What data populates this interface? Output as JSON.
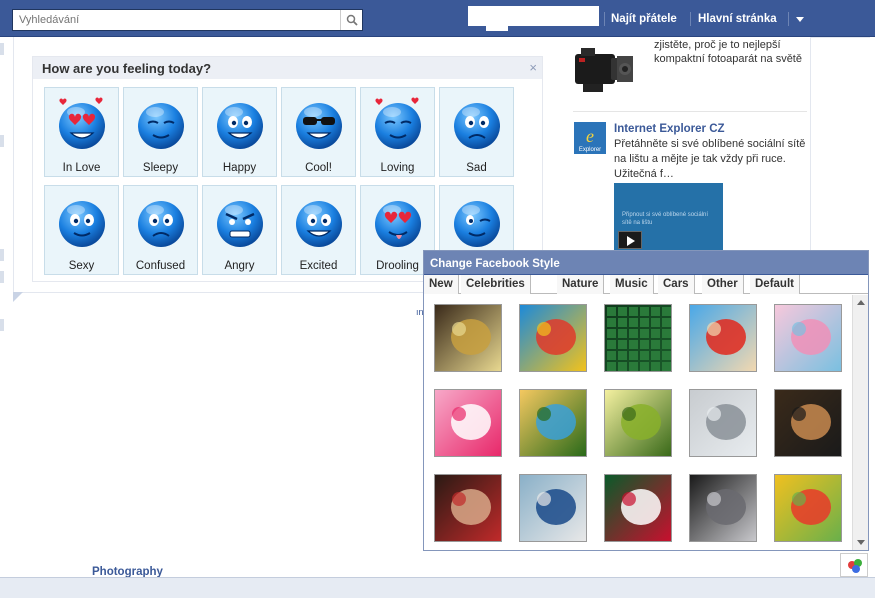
{
  "header": {
    "search_placeholder": "Vyhledávání",
    "nav_friends": "Najít přátele",
    "nav_home": "Hlavní stránka"
  },
  "feelings": {
    "title": "How are you feeling today?",
    "close": "×",
    "items": [
      {
        "label": "In Love"
      },
      {
        "label": "Sleepy"
      },
      {
        "label": "Happy"
      },
      {
        "label": "Cool!"
      },
      {
        "label": "Loving"
      },
      {
        "label": "Sad"
      },
      {
        "label": "Sexy"
      },
      {
        "label": "Confused"
      },
      {
        "label": "Angry"
      },
      {
        "label": "Excited"
      },
      {
        "label": "Drooling"
      },
      {
        "label": ""
      }
    ]
  },
  "sidebar": {
    "camera_text": "zjistěte, proč je to nejlepší kompaktní fotoaparát na světě",
    "ie_title": "Internet Explorer CZ",
    "ie_text": "Přetáhněte si své oblíbené sociální sítě na lištu a mějte je tak vždy při ruce. Užitečná f…",
    "video_caption": "Připnout si své oblíbené sociální sítě na lištu"
  },
  "style_popup": {
    "title": "Change Facebook Style",
    "tabs": [
      "New",
      "Celebrities",
      "Nature",
      "Music",
      "Cars",
      "Other",
      "Default"
    ]
  },
  "misc": {
    "small_text": "ın",
    "photography": "Photography"
  },
  "colors": {
    "brand_blue": "#3b5998",
    "popup_header": "#6d84b4",
    "emoticon_tile": "#eaf5fa"
  }
}
